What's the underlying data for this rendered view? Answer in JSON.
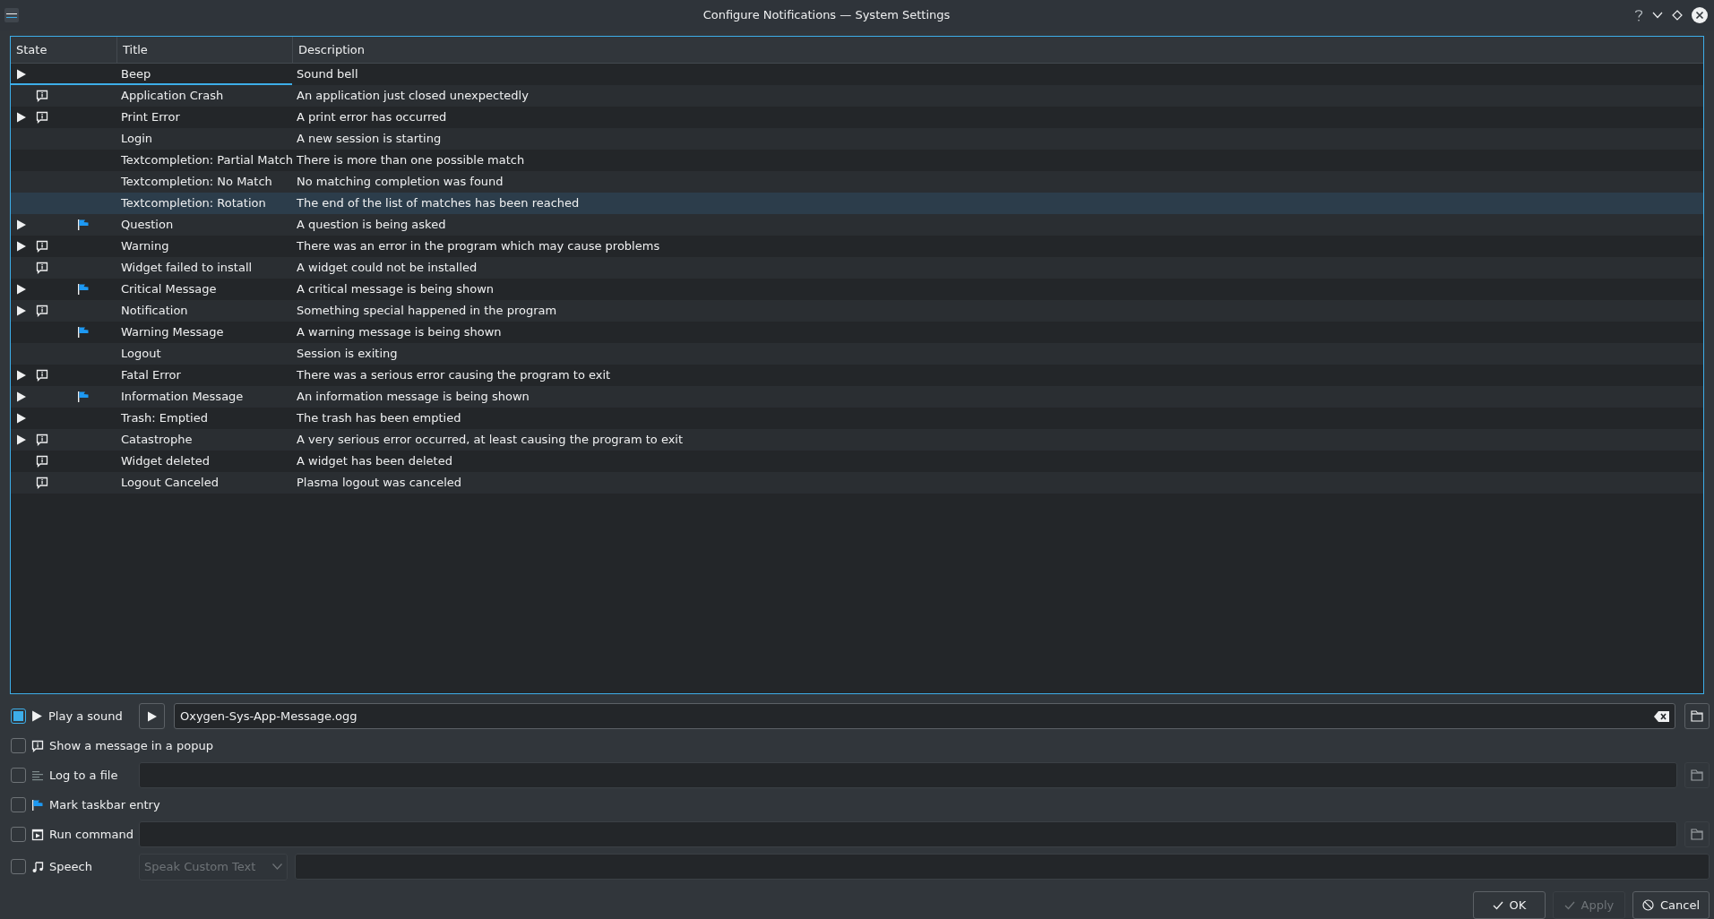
{
  "window": {
    "title": "Configure Notifications — System Settings"
  },
  "table": {
    "columns": [
      "State",
      "Title",
      "Description"
    ],
    "rows": [
      {
        "sound": true,
        "popup": false,
        "taskbar": false,
        "current": true,
        "hovered": false,
        "title": "Beep",
        "description": "Sound bell"
      },
      {
        "sound": false,
        "popup": true,
        "taskbar": false,
        "current": false,
        "hovered": false,
        "title": "Application Crash",
        "description": "An application just closed unexpectedly"
      },
      {
        "sound": true,
        "popup": true,
        "taskbar": false,
        "current": false,
        "hovered": false,
        "title": "Print Error",
        "description": "A print error has occurred"
      },
      {
        "sound": false,
        "popup": false,
        "taskbar": false,
        "current": false,
        "hovered": false,
        "title": "Login",
        "description": "A new session is starting"
      },
      {
        "sound": false,
        "popup": false,
        "taskbar": false,
        "current": false,
        "hovered": false,
        "title": "Textcompletion: Partial Match",
        "description": "There is more than one possible match"
      },
      {
        "sound": false,
        "popup": false,
        "taskbar": false,
        "current": false,
        "hovered": false,
        "title": "Textcompletion: No Match",
        "description": "No matching completion was found"
      },
      {
        "sound": false,
        "popup": false,
        "taskbar": false,
        "current": false,
        "hovered": true,
        "title": "Textcompletion: Rotation",
        "description": "The end of the list of matches has been reached"
      },
      {
        "sound": true,
        "popup": false,
        "taskbar": true,
        "current": false,
        "hovered": false,
        "title": "Question",
        "description": "A question is being asked"
      },
      {
        "sound": true,
        "popup": true,
        "taskbar": false,
        "current": false,
        "hovered": false,
        "title": "Warning",
        "description": "There was an error in the program which may cause problems"
      },
      {
        "sound": false,
        "popup": true,
        "taskbar": false,
        "current": false,
        "hovered": false,
        "title": "Widget failed to install",
        "description": "A widget could not be installed"
      },
      {
        "sound": true,
        "popup": false,
        "taskbar": true,
        "current": false,
        "hovered": false,
        "title": "Critical Message",
        "description": "A critical message is being shown"
      },
      {
        "sound": true,
        "popup": true,
        "taskbar": false,
        "current": false,
        "hovered": false,
        "title": "Notification",
        "description": "Something special happened in the program"
      },
      {
        "sound": false,
        "popup": false,
        "taskbar": true,
        "current": false,
        "hovered": false,
        "title": "Warning Message",
        "description": "A warning message is being shown"
      },
      {
        "sound": false,
        "popup": false,
        "taskbar": false,
        "current": false,
        "hovered": false,
        "title": "Logout",
        "description": "Session is exiting"
      },
      {
        "sound": true,
        "popup": true,
        "taskbar": false,
        "current": false,
        "hovered": false,
        "title": "Fatal Error",
        "description": "There was a serious error causing the program to exit"
      },
      {
        "sound": true,
        "popup": false,
        "taskbar": true,
        "current": false,
        "hovered": false,
        "title": "Information Message",
        "description": "An information message is being shown"
      },
      {
        "sound": true,
        "popup": false,
        "taskbar": false,
        "current": false,
        "hovered": false,
        "title": "Trash: Emptied",
        "description": "The trash has been emptied"
      },
      {
        "sound": true,
        "popup": true,
        "taskbar": false,
        "current": false,
        "hovered": false,
        "title": "Catastrophe",
        "description": "A very serious error occurred, at least causing the program to exit"
      },
      {
        "sound": false,
        "popup": true,
        "taskbar": false,
        "current": false,
        "hovered": false,
        "title": "Widget deleted",
        "description": "A widget has been deleted"
      },
      {
        "sound": false,
        "popup": true,
        "taskbar": false,
        "current": false,
        "hovered": false,
        "title": "Logout Canceled",
        "description": "Plasma logout was canceled"
      }
    ]
  },
  "actions": [
    {
      "kind": "sound",
      "label": "Play a sound",
      "checked": true,
      "value": "Oxygen-Sys-App-Message.ogg",
      "browse_disabled": false
    },
    {
      "kind": "popup",
      "label": "Show a message in a popup",
      "checked": false
    },
    {
      "kind": "log",
      "label": "Log to a file",
      "checked": false,
      "browse_disabled": true
    },
    {
      "kind": "taskbar",
      "label": "Mark taskbar entry",
      "checked": false
    },
    {
      "kind": "command",
      "label": "Run command",
      "checked": false,
      "browse_disabled": true
    },
    {
      "kind": "speech",
      "label": "Speech",
      "checked": false,
      "select": {
        "value": "Speak Custom Text",
        "disabled": true
      }
    }
  ],
  "buttons": [
    {
      "kind": "ok",
      "label": "OK",
      "disabled": false
    },
    {
      "kind": "apply",
      "label": "Apply",
      "disabled": true
    },
    {
      "kind": "cancel",
      "label": "Cancel",
      "disabled": false
    }
  ]
}
